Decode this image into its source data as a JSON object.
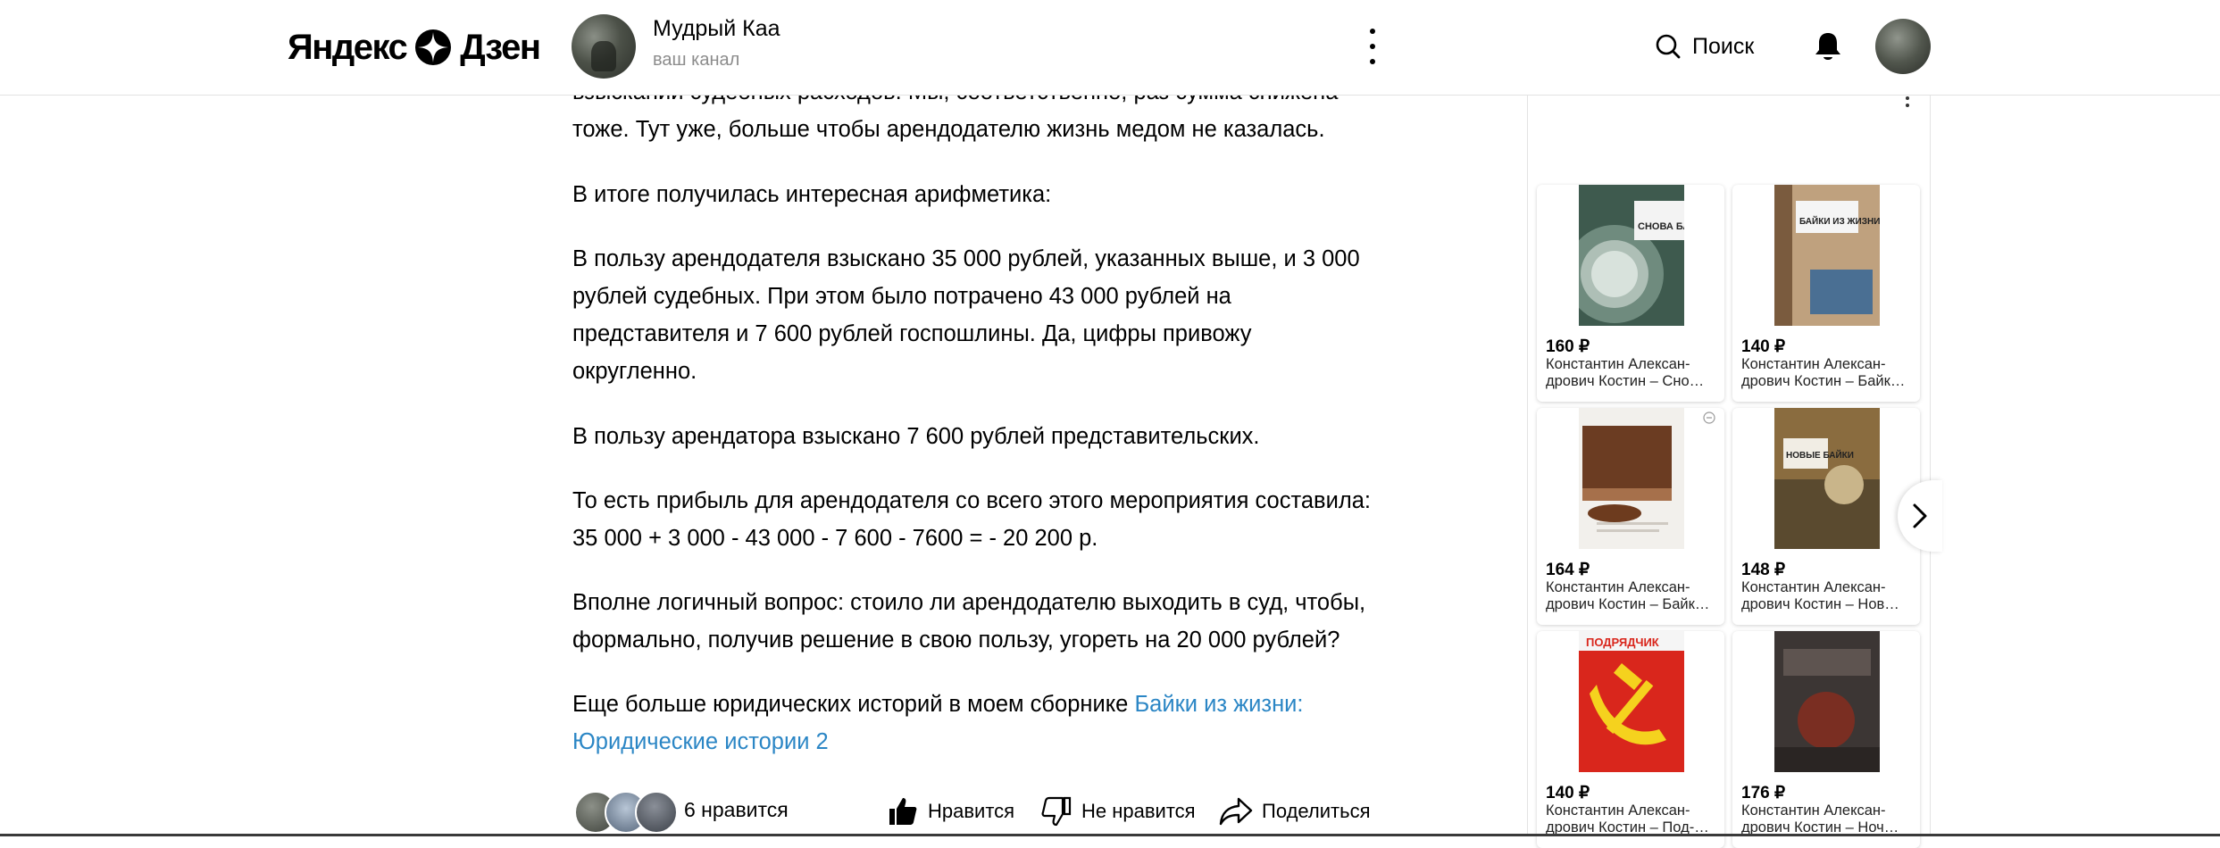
{
  "header": {
    "logo_left": "Яндекс",
    "logo_right": "Дзен",
    "channel_name": "Мудрый Каа",
    "channel_sub": "ваш канал",
    "search_label": "Поиск"
  },
  "article": {
    "top_partial": "взыскании судебных расходов. Мы, соответственно, раз сумма снижена",
    "top_line2": "тоже. Тут уже, больше чтобы арендодателю жизнь медом не казалась.",
    "p1": "В итоге получилась интересная арифметика:",
    "p2_lines": [
      "В пользу арендодателя взыскано 35 000 рублей, указанных выше, и 3 000",
      "рублей судебных. При этом было потрачено 43 000 рублей на",
      "представителя и 7 600 рублей госпошлины. Да, цифры привожу",
      "округленно."
    ],
    "p3": "В пользу арендатора взыскано 7 600 рублей представительских.",
    "p4_lines": [
      "То есть прибыль для арендодателя со всего этого мероприятия составила:",
      "35 000 + 3 000 - 43 000 - 7 600 - 7600 = - 20 200 р."
    ],
    "p5_lines": [
      "Вполне логичный вопрос: стоило ли арендодателю выходить в суд, чтобы,",
      "формально, получив решение в свою пользу, угореть на 20 000 рублей?"
    ],
    "p6_text": "Еще больше юридических историй в моем сборнике ",
    "p6_link_line1": "Байки из жизни:",
    "p6_link_line2": "Юридические истории 2"
  },
  "reactions": {
    "likes_count": "6 нравится",
    "like_label": "Нравится",
    "dislike_label": "Не нравится",
    "share_label": "Поделиться"
  },
  "sidebar": {
    "books": [
      {
        "price": "160 ₽",
        "author": "Константин Алексан-",
        "title": "дрович Костин – Сно…",
        "cover_text": "СНОВА БАЙКИ"
      },
      {
        "price": "140 ₽",
        "author": "Константин Алексан-",
        "title": "дрович Костин – Байк…",
        "cover_text": "БАЙКИ ИЗ ЖИЗНИ"
      },
      {
        "price": "164 ₽",
        "author": "Константин Алексан-",
        "title": "дрович Костин – Байк…",
        "cover_text": ""
      },
      {
        "price": "148 ₽",
        "author": "Константин Алексан-",
        "title": "дрович Костин – Нов…",
        "cover_text": "НОВЫЕ БАЙКИ"
      },
      {
        "price": "140 ₽",
        "author": "Константин Алексан-",
        "title": "дрович Костин – Под-…",
        "cover_text": "ПОДРЯДЧИК"
      },
      {
        "price": "176 ₽",
        "author": "Константин Алексан-",
        "title": "дрович Костин – Ноч…",
        "cover_text": ""
      }
    ]
  },
  "colors": {
    "link": "#2b86c5",
    "border": "#e3e3e3"
  }
}
